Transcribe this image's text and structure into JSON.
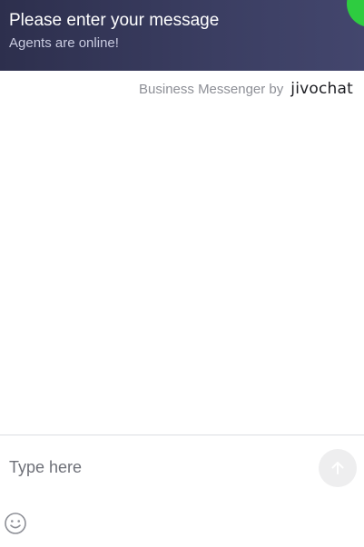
{
  "header": {
    "title": "Please enter your message",
    "subtitle": "Agents are online!",
    "status_color": "#2ecc40",
    "background_color": "#35375a"
  },
  "branding": {
    "text": "Business Messenger by",
    "logo_text": "jivochat",
    "logo_accent_color": "#2ecc40"
  },
  "composer": {
    "placeholder": "Type here",
    "value": "",
    "send_icon": "arrow-up-icon",
    "emoji_icon": "smiley-face-icon"
  }
}
